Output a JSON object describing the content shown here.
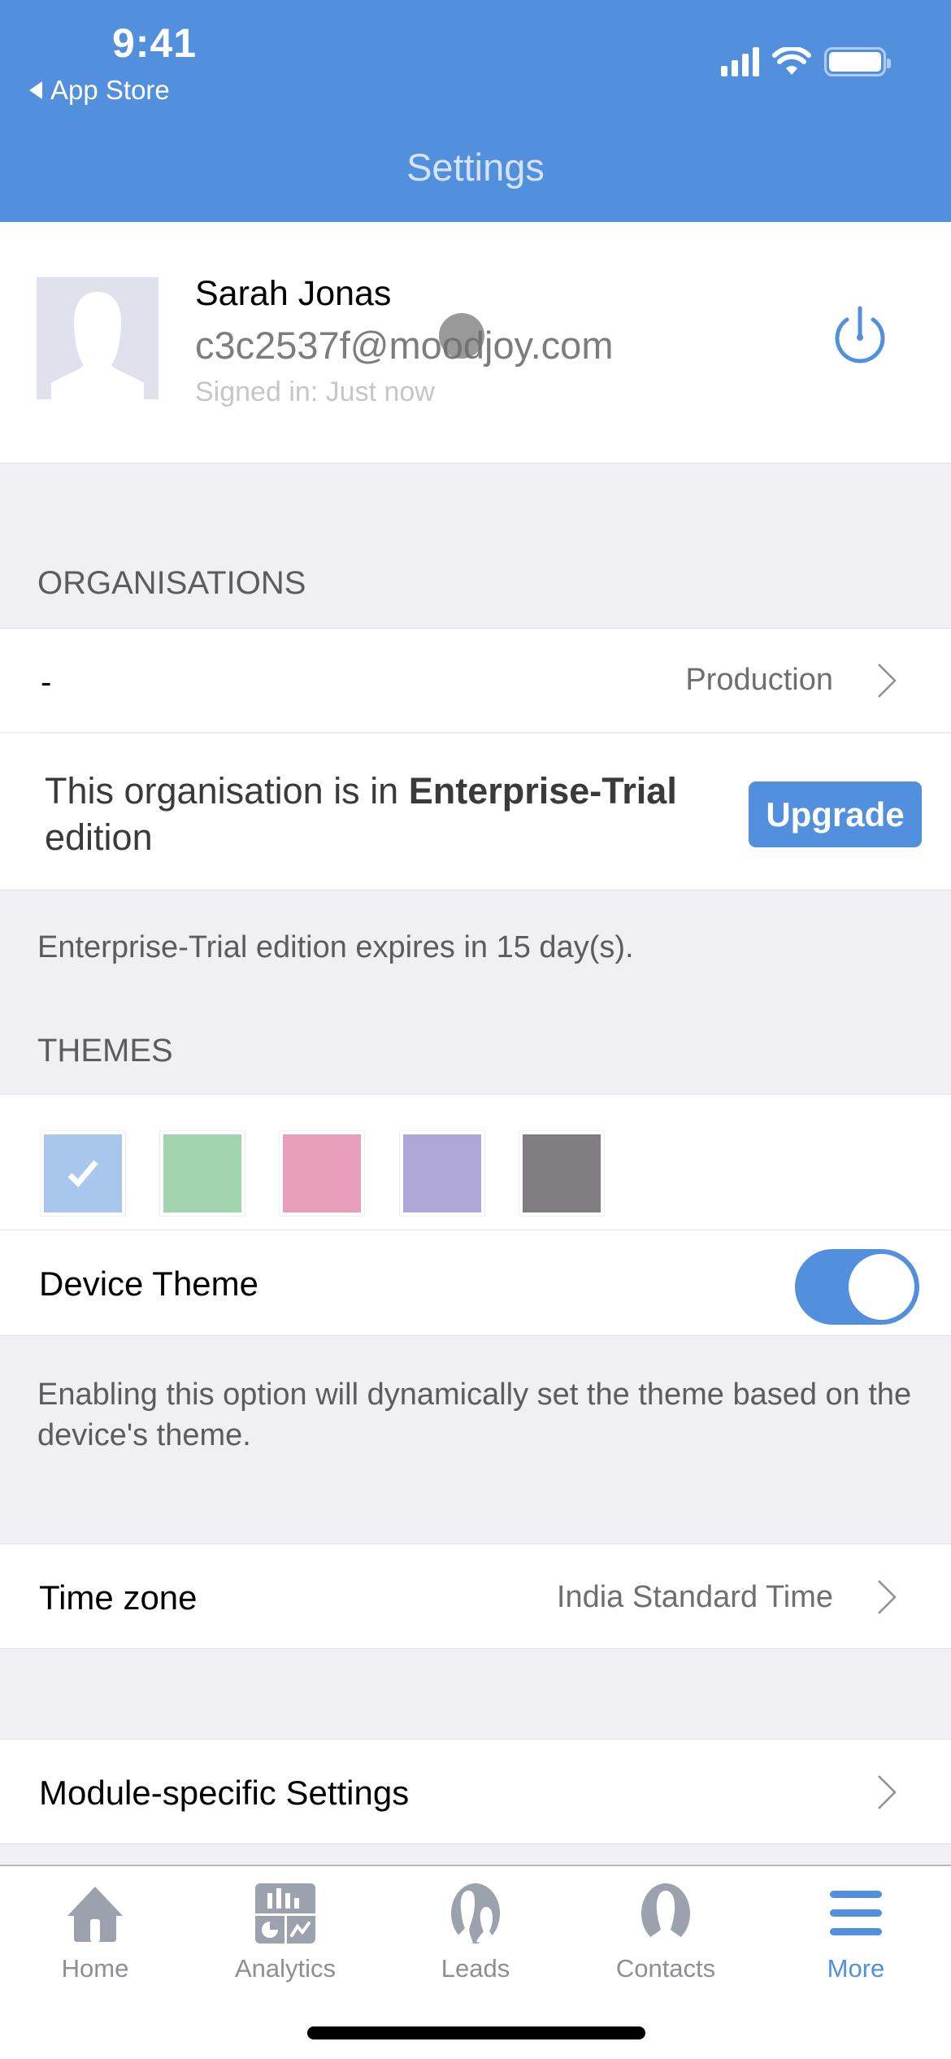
{
  "status_bar": {
    "time": "9:41",
    "back_label": "App Store",
    "icons": [
      "signal-icon",
      "wifi-icon",
      "battery-icon"
    ]
  },
  "header": {
    "title": "Settings"
  },
  "profile": {
    "name": "Sarah Jonas",
    "email": "c3c2537f@moodjoy.com",
    "signed_in": "Signed in: Just now",
    "avatar_icon": "person-silhouette-icon",
    "logout_icon": "power-icon"
  },
  "organisations": {
    "header": "ORGANISATIONS",
    "org_name": "-",
    "org_environment": "Production",
    "edition_prefix": "This organisation is in ",
    "edition_name": "Enterprise-Trial",
    "edition_suffix": " edition",
    "upgrade_label": "Upgrade",
    "expiry_note": "Enterprise-Trial edition expires in 15 day(s)."
  },
  "themes": {
    "header": "THEMES",
    "swatches": [
      {
        "name": "blue",
        "color": "#A9C6EC",
        "selected": true
      },
      {
        "name": "green",
        "color": "#A0D4AE",
        "selected": false
      },
      {
        "name": "pink",
        "color": "#E89FBC",
        "selected": false
      },
      {
        "name": "purple",
        "color": "#AFA8D6",
        "selected": false
      },
      {
        "name": "gray",
        "color": "#807E82",
        "selected": false
      }
    ],
    "device_theme_label": "Device Theme",
    "device_theme_enabled": true,
    "device_theme_note": "Enabling this option will dynamically set the theme based on the device's theme."
  },
  "time_zone": {
    "label": "Time zone",
    "value": "India Standard Time"
  },
  "module_settings": {
    "label": "Module-specific Settings"
  },
  "tab_bar": {
    "items": [
      {
        "label": "Home",
        "icon": "home-icon",
        "active": false
      },
      {
        "label": "Analytics",
        "icon": "analytics-icon",
        "active": false
      },
      {
        "label": "Leads",
        "icon": "leads-icon",
        "active": false
      },
      {
        "label": "Contacts",
        "icon": "contacts-icon",
        "active": false
      },
      {
        "label": "More",
        "icon": "menu-icon",
        "active": true
      }
    ]
  },
  "colors": {
    "accent": "#528FDD",
    "background": "#EFEFF4",
    "inactive_tab": "#9BA1AD"
  }
}
